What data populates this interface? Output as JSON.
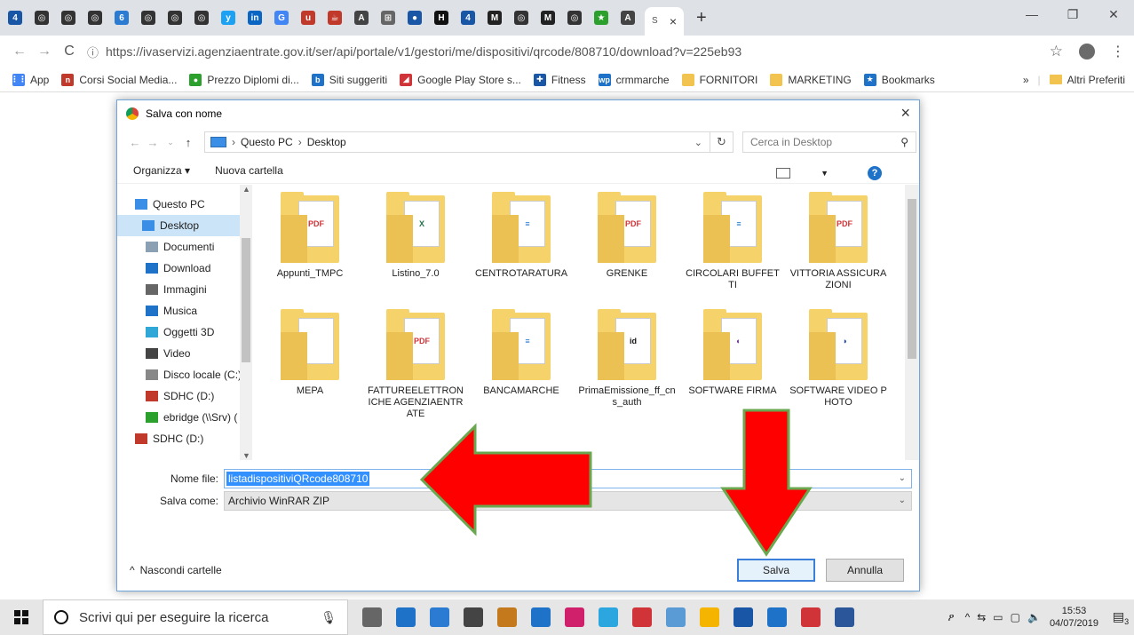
{
  "browser": {
    "url": "https://ivaservizi.agenziaentrate.gov.it/ser/api/portale/v1/gestori/me/dispositivi/qrcode/808710/download?v=225eb93",
    "active_tab_close": "×",
    "new_tab": "+",
    "tab_icons": [
      "4",
      "◎",
      "◎",
      "◎",
      "6",
      "◎",
      "◎",
      "◎",
      "y",
      "in",
      "G",
      "u",
      "☕",
      "A",
      "⊞",
      "●",
      "H",
      "4",
      "M",
      "◎",
      "M",
      "◎",
      "★",
      "A"
    ],
    "tab_colors": [
      "#1a56a6",
      "#333",
      "#333",
      "#333",
      "#2a7bd1",
      "#333",
      "#333",
      "#333",
      "#1da1f2",
      "#0a66c2",
      "#4285f4",
      "#c0392b",
      "#c0392b",
      "#444",
      "#666",
      "#1a56a6",
      "#111",
      "#1a56a6",
      "#222",
      "#333",
      "#222",
      "#333",
      "#2ca02c",
      "#444"
    ],
    "bookmarks": [
      {
        "label": "App",
        "icon_color": "#4285f4",
        "icon": "⋮⋮"
      },
      {
        "label": "Corsi Social Media...",
        "icon_color": "#c0392b",
        "icon": "n"
      },
      {
        "label": "Prezzo Diplomi di...",
        "icon_color": "#2ca02c",
        "icon": "●"
      },
      {
        "label": "Siti suggeriti",
        "icon_color": "#1e73c9",
        "icon": "b"
      },
      {
        "label": "Google Play Store s...",
        "icon_color": "#d13438",
        "icon": "◢"
      },
      {
        "label": "Fitness",
        "icon_color": "#1a56a6",
        "icon": "✚"
      },
      {
        "label": "crmmarche",
        "icon_color": "#1e73c9",
        "icon": "wp"
      },
      {
        "label": "FORNITORI",
        "icon_color": "#f2c44f",
        "icon": ""
      },
      {
        "label": "MARKETING",
        "icon_color": "#f2c44f",
        "icon": ""
      },
      {
        "label": "Bookmarks",
        "icon_color": "#1e73c9",
        "icon": "★"
      }
    ],
    "bookmarks_more": "»",
    "other_bookmarks": "Altri Preferiti"
  },
  "dialog": {
    "title": "Salva con nome",
    "close": "×",
    "path": [
      "Questo PC",
      "Desktop"
    ],
    "search_placeholder": "Cerca in Desktop",
    "toolbar": {
      "organize": "Organizza ▾",
      "new_folder": "Nuova cartella"
    },
    "nav_items": [
      {
        "label": "Questo PC",
        "icon_color": "#3a8ee6",
        "selected": false,
        "sub": false
      },
      {
        "label": "Desktop",
        "icon_color": "#3a8ee6",
        "selected": true,
        "sub": true
      },
      {
        "label": "Documenti",
        "icon_color": "#8ca0b3",
        "selected": false,
        "sub": true
      },
      {
        "label": "Download",
        "icon_color": "#1e73c9",
        "selected": false,
        "sub": true
      },
      {
        "label": "Immagini",
        "icon_color": "#666",
        "selected": false,
        "sub": true
      },
      {
        "label": "Musica",
        "icon_color": "#1e73c9",
        "selected": false,
        "sub": true
      },
      {
        "label": "Oggetti 3D",
        "icon_color": "#2fa8d8",
        "selected": false,
        "sub": true
      },
      {
        "label": "Video",
        "icon_color": "#444",
        "selected": false,
        "sub": true
      },
      {
        "label": "Disco locale (C:)",
        "icon_color": "#888",
        "selected": false,
        "sub": true
      },
      {
        "label": "SDHC (D:)",
        "icon_color": "#c0392b",
        "selected": false,
        "sub": true
      },
      {
        "label": "ebridge (\\\\Srv) (",
        "icon_color": "#2ca02c",
        "selected": false,
        "sub": true
      },
      {
        "label": "SDHC (D:)",
        "icon_color": "#c0392b",
        "selected": false,
        "sub": false
      }
    ],
    "files": [
      {
        "name": "Appunti_TMPC",
        "doc": "PDF",
        "doc_color": "#d13438"
      },
      {
        "name": "Listino_7.0",
        "doc": "X",
        "doc_color": "#1e7145"
      },
      {
        "name": "CENTROTARATURA",
        "doc": "≡",
        "doc_color": "#1e73c9"
      },
      {
        "name": "GRENKE",
        "doc": "PDF",
        "doc_color": "#d13438"
      },
      {
        "name": "CIRCOLARI BUFFETTI",
        "doc": "≡",
        "doc_color": "#1e73c9"
      },
      {
        "name": "VITTORIA ASSICURAZIONI",
        "doc": "PDF",
        "doc_color": "#d13438"
      },
      {
        "name": "MEPA",
        "doc": "",
        "doc_color": "#999"
      },
      {
        "name": "FATTUREELETTRONICHE AGENZIAENTRATE",
        "doc": "PDF",
        "doc_color": "#d13438"
      },
      {
        "name": "BANCAMARCHE",
        "doc": "≡",
        "doc_color": "#1e73c9"
      },
      {
        "name": "PrimaEmissione_ff_cns_auth",
        "doc": "id",
        "doc_color": "#111"
      },
      {
        "name": "SOFTWARE FIRMA",
        "doc": "◐",
        "doc_color": "#6a2c91"
      },
      {
        "name": "SOFTWARE VIDEO PHOTO",
        "doc": "◑",
        "doc_color": "#1a3fa6"
      }
    ],
    "filename_label": "Nome file:",
    "filename_value": "listadispositiviQRcode808710",
    "filetype_label": "Salva come:",
    "filetype_value": "Archivio WinRAR ZIP",
    "hide_folders": "Nascondi cartelle",
    "save_button": "Salva",
    "cancel_button": "Annulla"
  },
  "annotations": {
    "arrow_color": "#ff0000",
    "arrow_border": "#6aa84f"
  },
  "taskbar": {
    "search_placeholder": "Scrivi qui per eseguire la ricerca",
    "apps": [
      "#666",
      "#1e73c9",
      "#2a7bd1",
      "#444",
      "#c47a1c",
      "#1e73c9",
      "#d01f6b",
      "#2ca6de",
      "#d13438",
      "#5b9bd5",
      "#f4b400",
      "#1a56a6",
      "#1e73c9",
      "#d13438",
      "#2b579a"
    ],
    "time": "15:53",
    "date": "04/07/2019",
    "notifications": "3"
  }
}
